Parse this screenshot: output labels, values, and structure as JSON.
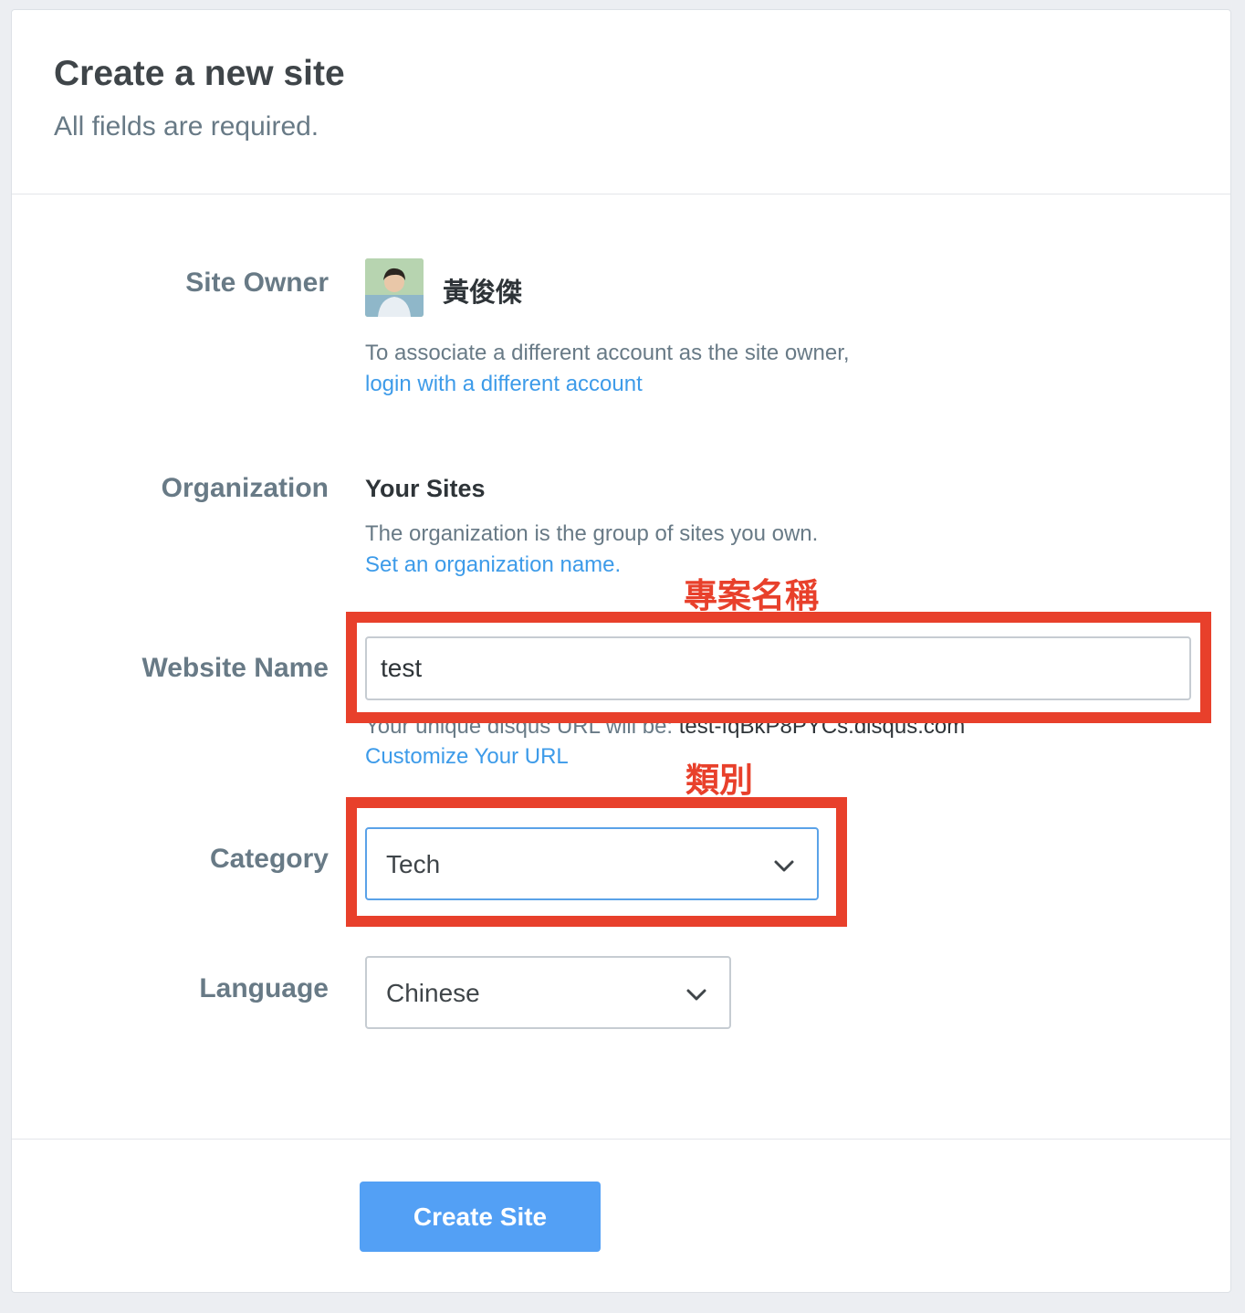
{
  "header": {
    "title": "Create a new site",
    "subtitle": "All fields are required."
  },
  "site_owner": {
    "label": "Site Owner",
    "name": "黃俊傑",
    "help": "To associate a different account as the site owner,",
    "link": "login with a different account"
  },
  "organization": {
    "label": "Organization",
    "name": "Your Sites",
    "help": "The organization is the group of sites you own.",
    "link": "Set an organization name."
  },
  "website_name": {
    "label": "Website Name",
    "value": "test",
    "url_prefix": "Your unique disqus URL will be:",
    "url_value": "test-fqBkP8PYCs.disqus.com",
    "customize_link": "Customize Your URL"
  },
  "category": {
    "label": "Category",
    "selected": "Tech"
  },
  "language": {
    "label": "Language",
    "selected": "Chinese"
  },
  "submit": {
    "label": "Create Site"
  },
  "annotations": {
    "project_name": "專案名稱",
    "category": "類別"
  },
  "colors": {
    "accent": "#3d9be9",
    "button": "#53a0f5",
    "annotation": "#e8402b",
    "label": "#687a86"
  }
}
